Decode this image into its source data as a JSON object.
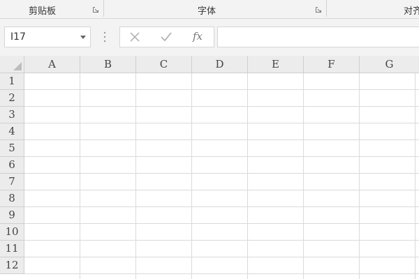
{
  "ribbon": {
    "groups": [
      {
        "label": "剪贴板"
      },
      {
        "label": "字体"
      },
      {
        "label": "对齐方式"
      }
    ]
  },
  "formula_bar": {
    "name_box_value": "I17",
    "cancel_icon": "close-icon",
    "enter_icon": "check-icon",
    "insert_function_label": "fx",
    "formula_value": ""
  },
  "sheet": {
    "columns": [
      "A",
      "B",
      "C",
      "D",
      "E",
      "F",
      "G"
    ],
    "rows": [
      "1",
      "2",
      "3",
      "4",
      "5",
      "6",
      "7",
      "8",
      "9",
      "10",
      "11",
      "12"
    ]
  },
  "colors": {
    "header_bg": "#ececec",
    "ribbon_bg": "#f3f3f3",
    "gridline": "#dadada"
  }
}
